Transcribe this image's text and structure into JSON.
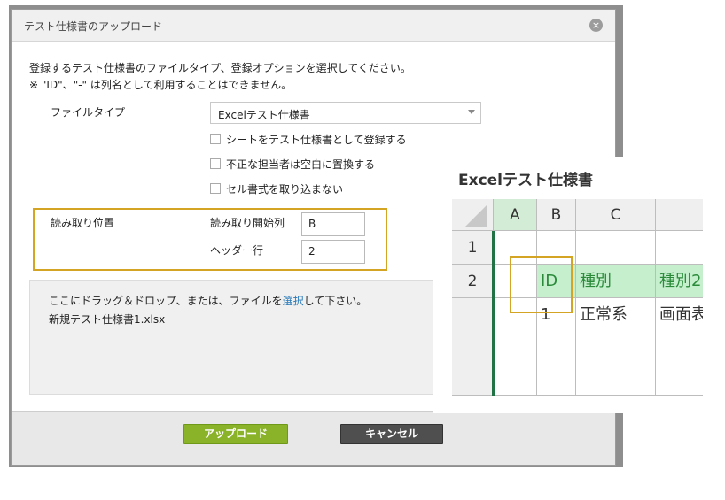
{
  "dialog": {
    "title": "テスト仕様書のアップロード",
    "close_icon": "close-icon",
    "description_line1": "登録するテスト仕様書のファイルタイプ、登録オプションを選択してください。",
    "description_line2": "※ \"ID\"、\"-\" は列名として利用することはできません。",
    "file_type": {
      "label": "ファイルタイプ",
      "selected": "Excelテスト仕様書"
    },
    "options": [
      {
        "label": "シートをテスト仕様書として登録する",
        "checked": false
      },
      {
        "label": "不正な担当者は空白に置換する",
        "checked": false
      },
      {
        "label": "セル書式を取り込まない",
        "checked": false
      }
    ],
    "read_position": {
      "label": "読み取り位置",
      "start_column_label": "読み取り開始列",
      "start_column_value": "B",
      "header_row_label": "ヘッダー行",
      "header_row_value": "2"
    },
    "dropzone": {
      "text_before": "ここにドラッグ＆ドロップ、または、ファイルを",
      "link": "選択",
      "text_after": "して下さい。",
      "file_name": "新規テスト仕様書1.xlsx"
    },
    "buttons": {
      "upload": "アップロード",
      "cancel": "キャンセル"
    }
  },
  "excel_preview": {
    "title": "Excelテスト仕様書",
    "columns": [
      "A",
      "B",
      "C",
      ""
    ],
    "rows": [
      "1",
      "2",
      ""
    ],
    "row2": [
      "",
      "ID",
      "種別",
      "種別2"
    ],
    "row3": [
      "",
      "1",
      "正常系",
      "画面表"
    ]
  },
  "colors": {
    "upload_button": "#8ab32a",
    "cancel_button": "#4f4f4f",
    "highlight": "#d4a524",
    "header_cell_green": "#c6efce",
    "link": "#2a7ab8"
  }
}
